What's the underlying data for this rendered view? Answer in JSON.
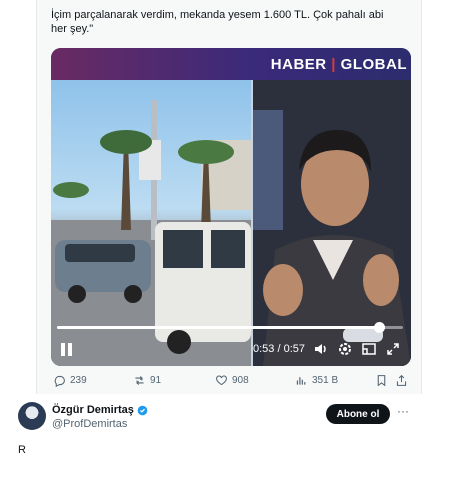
{
  "tweet": {
    "text": "İçim parçalanarak verdim, mekanda yesem 1.600 TL. Çok pahalı abi her şey.\""
  },
  "video": {
    "brand_left": "HABER",
    "brand_right": "GLOBAL",
    "time_display": "0:53 / 0:57",
    "progress_fraction": 0.93,
    "icons": [
      "pause-icon",
      "volume-icon",
      "settings-icon",
      "pip-icon",
      "fullscreen-icon"
    ]
  },
  "actions": {
    "replies": "239",
    "reposts": "91",
    "likes": "908",
    "views": "351 B"
  },
  "author": {
    "name": "Özgür Demirtaş",
    "handle": "@ProfDemirtas",
    "subscribe_label": "Abone ol",
    "more_label": "···"
  },
  "reply": {
    "text": "R"
  },
  "colors": {
    "verified": "#1d9bf0",
    "muted_text": "#536471",
    "brand_separator": "#e03b3b"
  }
}
